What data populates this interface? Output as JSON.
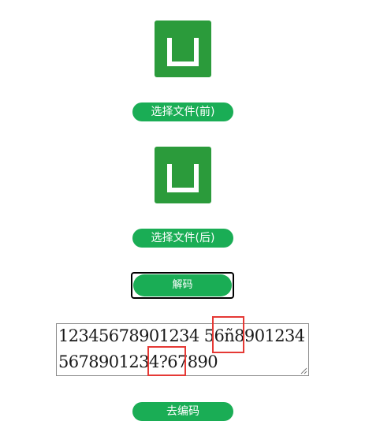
{
  "before": {
    "icon": "upload-tray-icon",
    "button_label": "选择文件(前)"
  },
  "after": {
    "icon": "upload-tray-icon",
    "button_label": "选择文件(后)"
  },
  "decode": {
    "button_label": "解码"
  },
  "textarea": {
    "line1": "12345678901234 56ñ8901234",
    "line2": "5678901234?67890"
  },
  "encode": {
    "button_label": "去编码"
  },
  "colors": {
    "icon_green": "#2b9b3b",
    "button_green": "#1aad55",
    "highlight_red": "#e53935"
  }
}
